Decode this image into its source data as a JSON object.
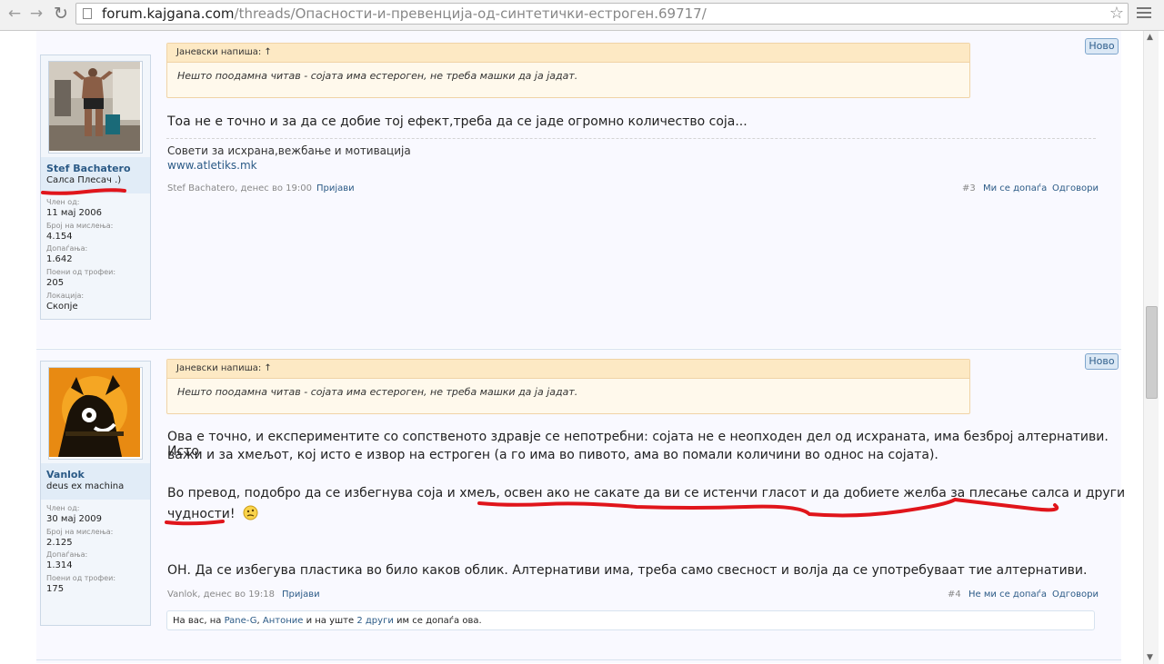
{
  "browser": {
    "url_host": "forum.kajgana.com",
    "url_path": "/threads/Опасности-и-превенција-од-синтетички-естроген.69717/"
  },
  "posts": [
    {
      "new_label": "Ново",
      "username": "Stef Bachatero",
      "user_title": "Салса Плесач .)",
      "stats": [
        {
          "label": "Член од:",
          "value": "11 мај 2006"
        },
        {
          "label": "Број на мислења:",
          "value": "4.154"
        },
        {
          "label": "Допаѓања:",
          "value": "1.642"
        },
        {
          "label": "Поени од трофеи:",
          "value": "205"
        },
        {
          "label": "Локација:",
          "value": "Скопје"
        }
      ],
      "quote_author": "Јаневски напиша: ↑",
      "quote_text": "Нешто поодамна читав - сојата има естероген, не треба машки да ја јадат.",
      "message": "Тоа не е точно и за да се добие тој ефект,треба да се јаде огромно количество соја...",
      "signature": "Совети за исхрана,вежбање и мотивација",
      "signature_link": "www.atletiks.mk",
      "meta_author_time": "Stef Bachatero, денес во 19:00",
      "report": "Пријави",
      "post_number": "#3",
      "like": "Ми се допаѓа",
      "reply": "Одговори"
    },
    {
      "new_label": "Ново",
      "username": "Vanlok",
      "user_title": "deus ex machina",
      "stats": [
        {
          "label": "Член од:",
          "value": "30 мај 2009"
        },
        {
          "label": "Број на мислења:",
          "value": "2.125"
        },
        {
          "label": "Допаѓања:",
          "value": "1.314"
        },
        {
          "label": "Поени од трофеи:",
          "value": "175"
        }
      ],
      "quote_author": "Јаневски напиша: ↑",
      "quote_text": "Нешто поодамна читав - сојата има естероген, не треба машки да ја јадат.",
      "message_p1_l1": "Ова е точно, и експериментите со сопственото здравје се непотребни: сојата не е неопходен дел од исхраната, има безброј алтернативи. Исто",
      "message_p1_l2": "важи и за хмељот, кој исто е извор на естроген (а го има во пивото, ама во помали количини во однос на сојата).",
      "message_p2_l1": "Во превод, подобро да се избегнува соја и хмељ, освен ако не сакате да ви се истенчи гласот и да добиете желба за плесање салса и други",
      "message_p2_l2": "чудности!",
      "message_p3": "ОН. Да се избегува пластика во било каков облик. Алтернативи има, треба само свесност и волја да се употребуваат тие алтернативи.",
      "meta_author_time": "Vanlok, денес во 19:18",
      "report": "Пријави",
      "post_number": "#4",
      "unlike": "Не ми се допаѓа",
      "reply": "Одговори",
      "likes_prefix": "На вас, на",
      "likes_user1": "Pane-G",
      "likes_sep": ",",
      "likes_user2": "Антоние",
      "likes_mid": "и на уште",
      "likes_others": "2 други",
      "likes_suffix": "им се допаѓа ова."
    }
  ],
  "colors": {
    "link": "#2b5a86",
    "annotation_red": "#e0151b"
  }
}
